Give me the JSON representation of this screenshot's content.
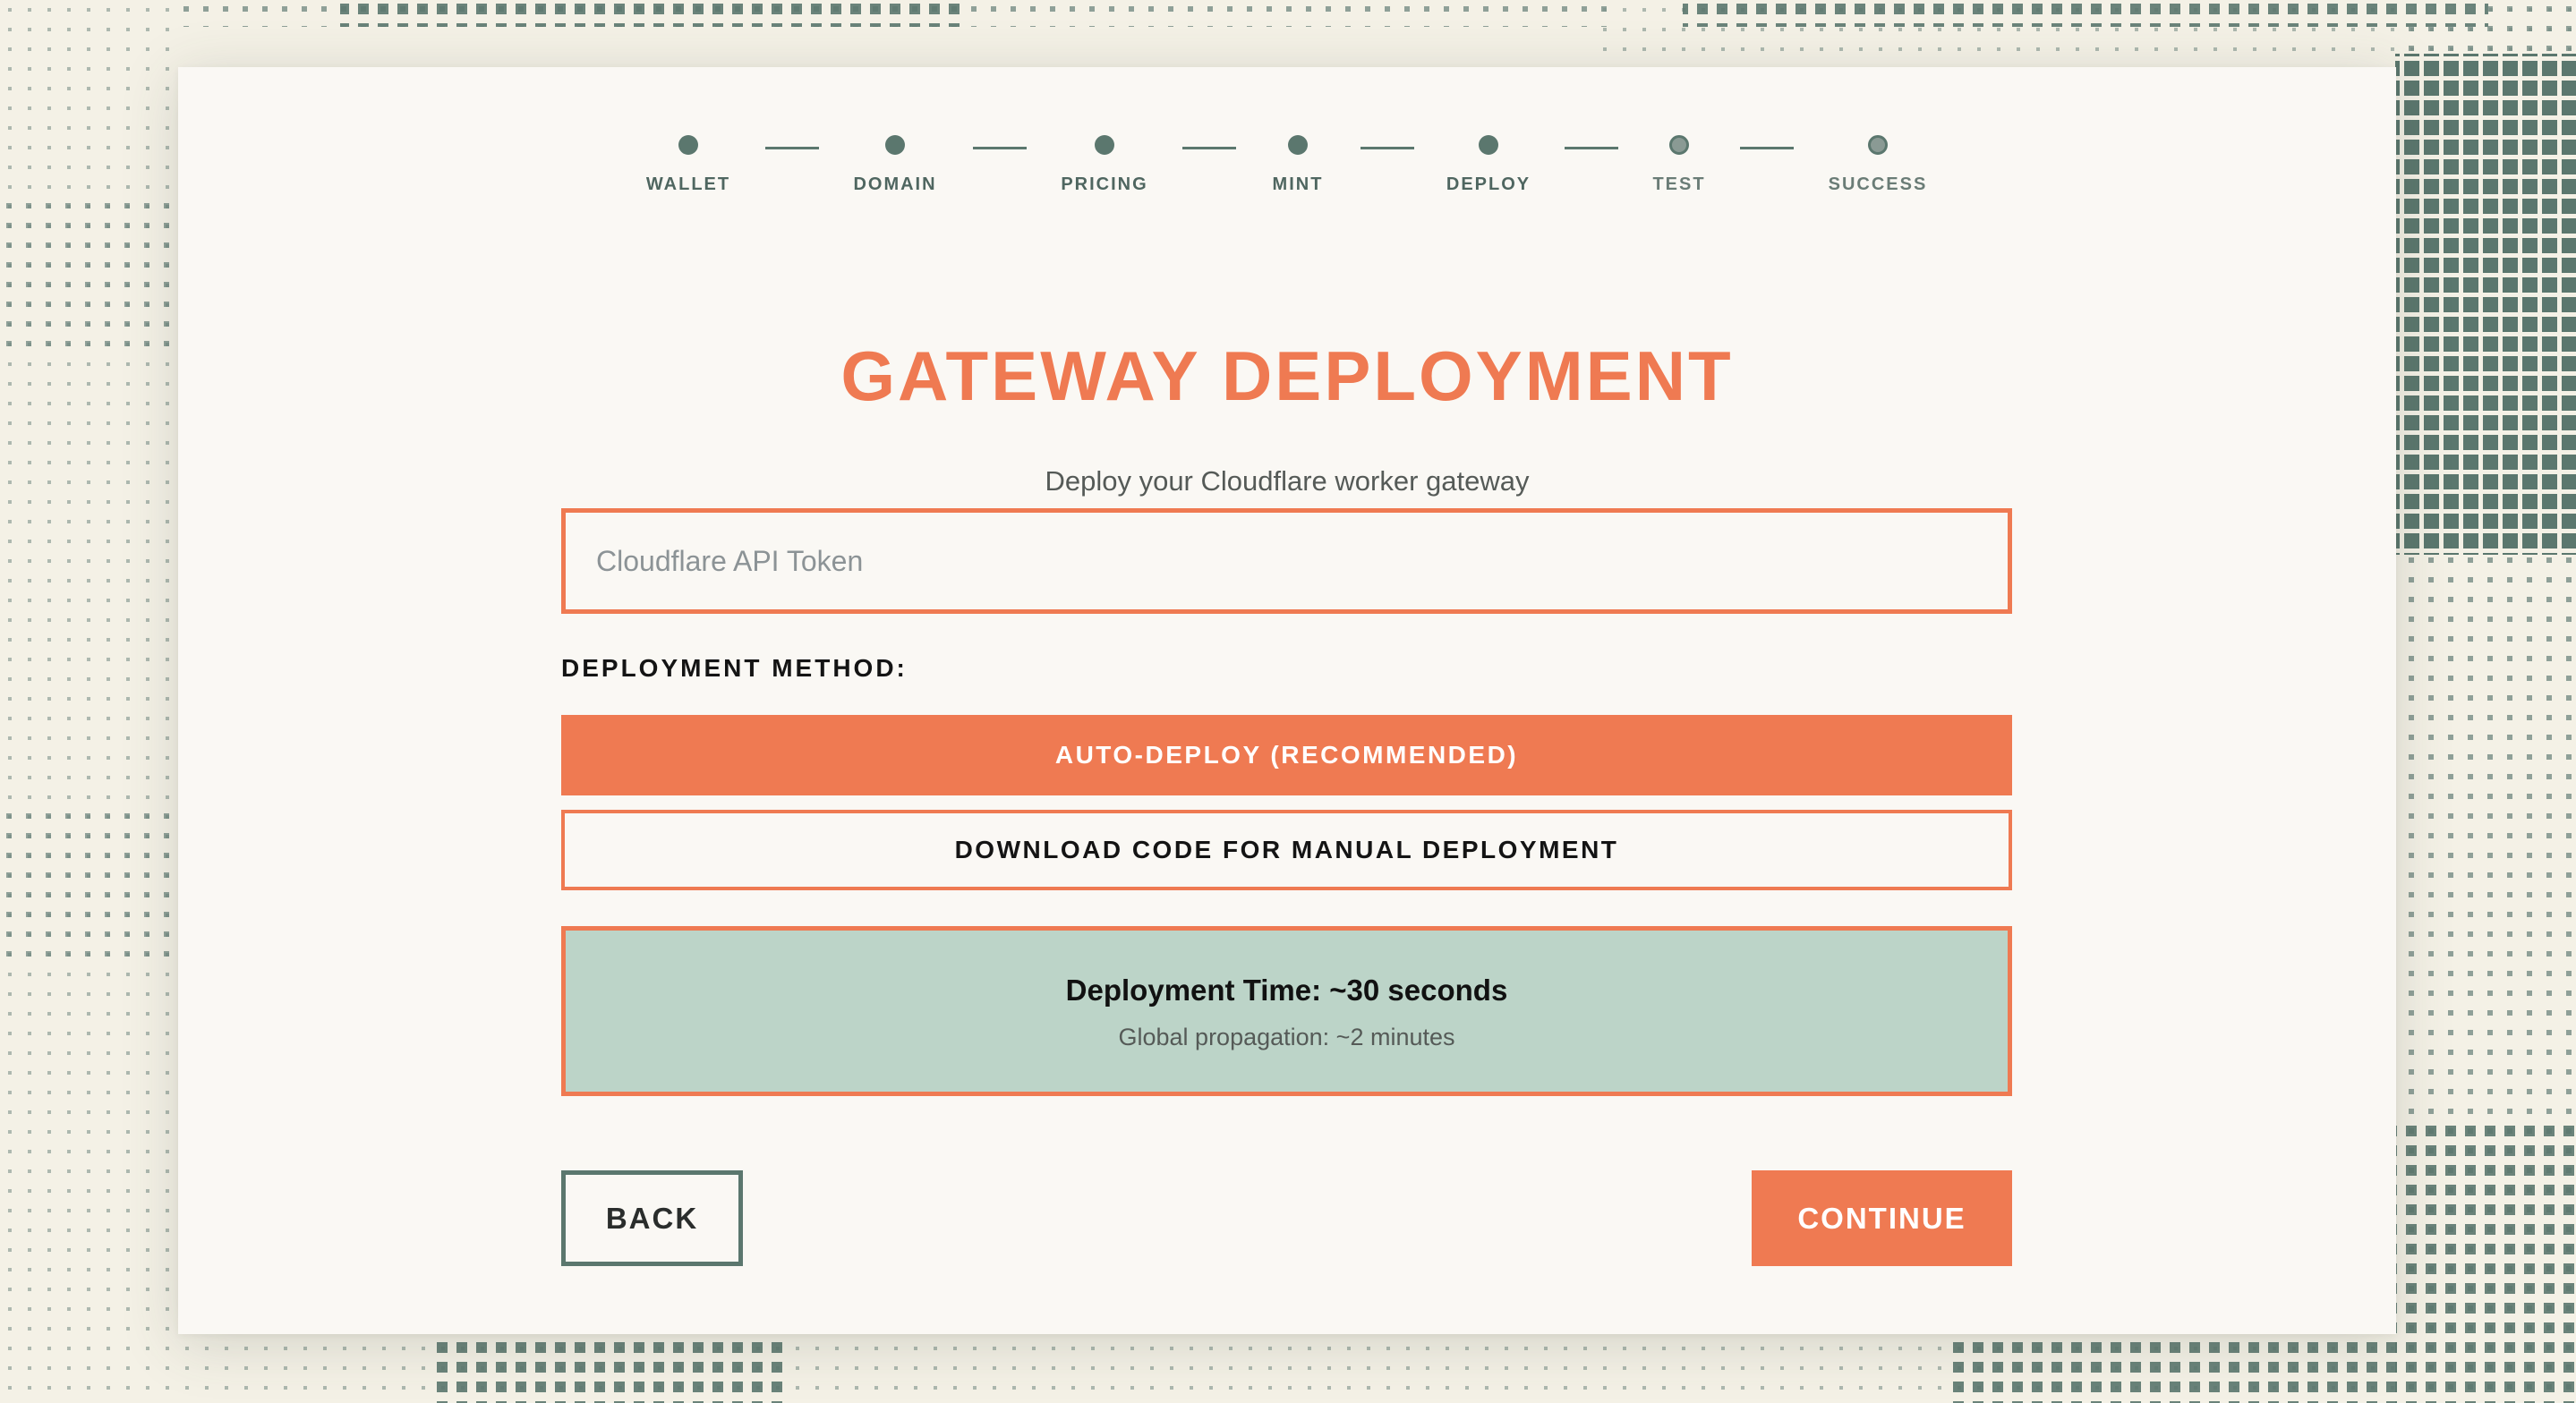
{
  "colors": {
    "accent": "#ef7a52",
    "stepper": "#5b776e",
    "info_background": "#bcd4c8",
    "card_background": "#faf8f4",
    "page_background": "#f4f1e6"
  },
  "stepper": {
    "steps": [
      {
        "label": "WALLET",
        "state": "complete"
      },
      {
        "label": "DOMAIN",
        "state": "complete"
      },
      {
        "label": "PRICING",
        "state": "complete"
      },
      {
        "label": "MINT",
        "state": "complete"
      },
      {
        "label": "DEPLOY",
        "state": "current"
      },
      {
        "label": "TEST",
        "state": "pending"
      },
      {
        "label": "SUCCESS",
        "state": "pending"
      }
    ]
  },
  "page": {
    "title": "GATEWAY DEPLOYMENT",
    "subtitle": "Deploy your Cloudflare worker gateway"
  },
  "form": {
    "token_value": "",
    "token_placeholder": "Cloudflare API Token",
    "method_label": "DEPLOYMENT METHOD:",
    "auto_deploy_label": "AUTO-DEPLOY (RECOMMENDED)",
    "manual_deploy_label": "DOWNLOAD CODE FOR MANUAL DEPLOYMENT",
    "selected_method": "auto"
  },
  "info": {
    "title": "Deployment Time: ~30 seconds",
    "subtitle": "Global propagation: ~2 minutes"
  },
  "nav": {
    "back_label": "BACK",
    "continue_label": "CONTINUE"
  }
}
